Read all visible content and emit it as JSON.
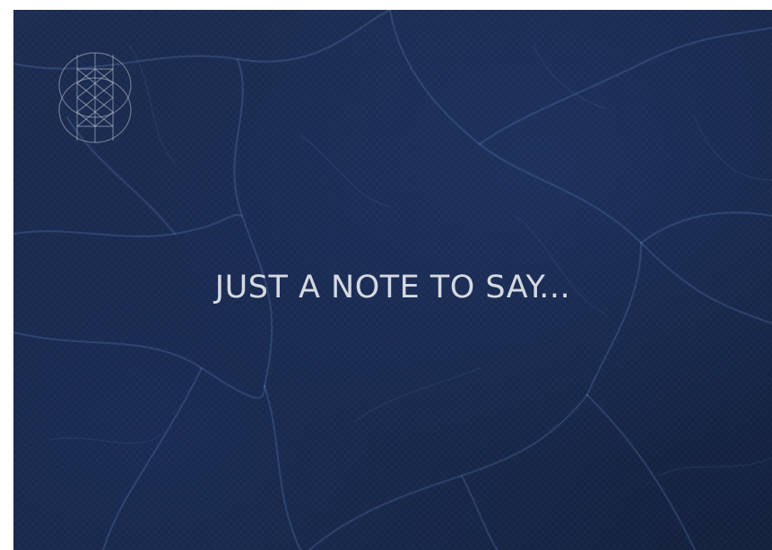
{
  "card": {
    "headline": "JUST A NOTE TO SAY...",
    "logo_icon": "geometric-crest-icon",
    "background_color": "#172648",
    "text_color": "#d6d9e2",
    "texture": "dark navy leather with light blue cracks"
  }
}
